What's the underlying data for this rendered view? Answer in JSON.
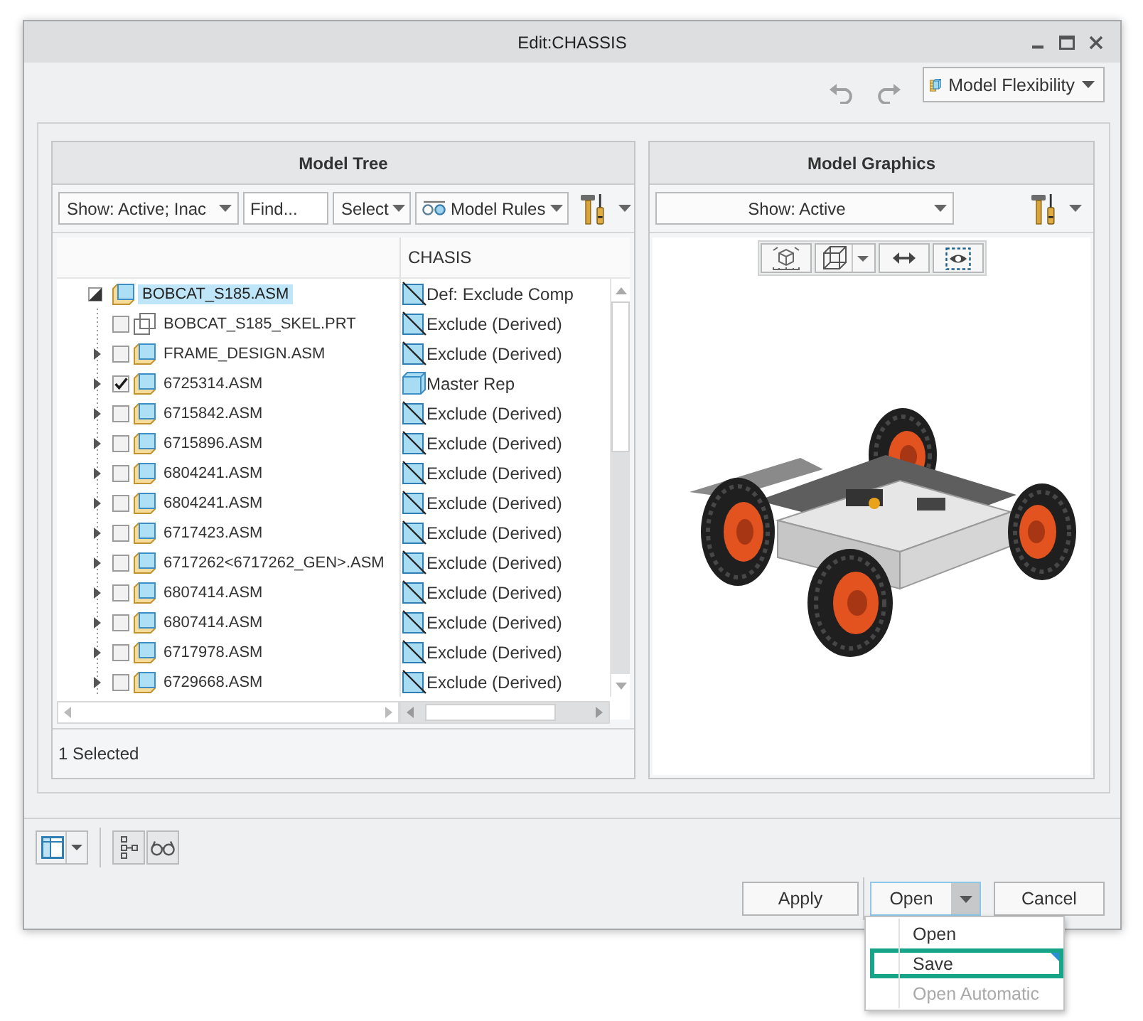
{
  "window": {
    "title": "Edit:CHASSIS"
  },
  "toolbar": {
    "flexibility_menu": "Model Flexibility"
  },
  "model_tree": {
    "title": "Model Tree",
    "show_filter": "Show: Active; Inac",
    "find": {
      "placeholder": "Find..."
    },
    "select_menu": "Select",
    "rules_menu": "Model Rules",
    "column_header": "CHASIS",
    "root": {
      "name": "BOBCAT_S185.ASM",
      "rep": {
        "label": "Def: Exclude Comp",
        "kind": "exclude"
      },
      "kind": "assembly",
      "expanded": true,
      "selected": true,
      "children": [
        {
          "name": "BOBCAT_S185_SKEL.PRT",
          "rep": {
            "label": "Exclude (Derived)",
            "kind": "exclude"
          },
          "kind": "part",
          "checked": false,
          "selected": false
        },
        {
          "name": "FRAME_DESIGN.ASM",
          "rep": {
            "label": "Exclude (Derived)",
            "kind": "exclude"
          },
          "kind": "assembly",
          "checked": false,
          "selected": false,
          "expanded": false
        },
        {
          "name": "6725314.ASM",
          "rep": {
            "label": "Master Rep",
            "kind": "master"
          },
          "kind": "assembly",
          "checked": true,
          "selected": false,
          "expanded": false
        },
        {
          "name": "6715842.ASM",
          "rep": {
            "label": "Exclude (Derived)",
            "kind": "exclude"
          },
          "kind": "assembly",
          "checked": false,
          "selected": false,
          "expanded": false
        },
        {
          "name": "6715896.ASM",
          "rep": {
            "label": "Exclude (Derived)",
            "kind": "exclude"
          },
          "kind": "assembly",
          "checked": false,
          "selected": false,
          "expanded": false
        },
        {
          "name": "6804241.ASM",
          "rep": {
            "label": "Exclude (Derived)",
            "kind": "exclude"
          },
          "kind": "assembly",
          "checked": false,
          "selected": false,
          "expanded": false
        },
        {
          "name": "6804241.ASM",
          "rep": {
            "label": "Exclude (Derived)",
            "kind": "exclude"
          },
          "kind": "assembly",
          "checked": false,
          "selected": false,
          "expanded": false
        },
        {
          "name": "6717423.ASM",
          "rep": {
            "label": "Exclude (Derived)",
            "kind": "exclude"
          },
          "kind": "assembly",
          "checked": false,
          "selected": false,
          "expanded": false
        },
        {
          "name": "6717262<6717262_GEN>.ASM",
          "rep": {
            "label": "Exclude (Derived)",
            "kind": "exclude"
          },
          "kind": "assembly",
          "checked": false,
          "selected": false,
          "expanded": false
        },
        {
          "name": "6807414.ASM",
          "rep": {
            "label": "Exclude (Derived)",
            "kind": "exclude"
          },
          "kind": "assembly",
          "checked": false,
          "selected": false,
          "expanded": false
        },
        {
          "name": "6807414.ASM",
          "rep": {
            "label": "Exclude (Derived)",
            "kind": "exclude"
          },
          "kind": "assembly",
          "checked": false,
          "selected": false,
          "expanded": false
        },
        {
          "name": "6717978.ASM",
          "rep": {
            "label": "Exclude (Derived)",
            "kind": "exclude"
          },
          "kind": "assembly",
          "checked": false,
          "selected": false,
          "expanded": false
        },
        {
          "name": "6729668.ASM",
          "rep": {
            "label": "Exclude (Derived)",
            "kind": "exclude"
          },
          "kind": "assembly",
          "checked": false,
          "selected": false,
          "expanded": false
        }
      ]
    },
    "status": "1 Selected"
  },
  "model_graphics": {
    "title": "Model Graphics",
    "show_filter": "Show: Active"
  },
  "footer": {
    "actions": [
      {
        "label": "Apply",
        "kind": "button"
      },
      {
        "label": "Open",
        "kind": "split",
        "menu_open": true,
        "menu": [
          {
            "label": "Open",
            "selected": false,
            "disabled": false
          },
          {
            "label": "Save",
            "selected": true,
            "disabled": false
          },
          {
            "label": "Open Automatic",
            "selected": false,
            "disabled": true
          }
        ]
      },
      {
        "label": "Cancel",
        "kind": "button"
      }
    ]
  }
}
